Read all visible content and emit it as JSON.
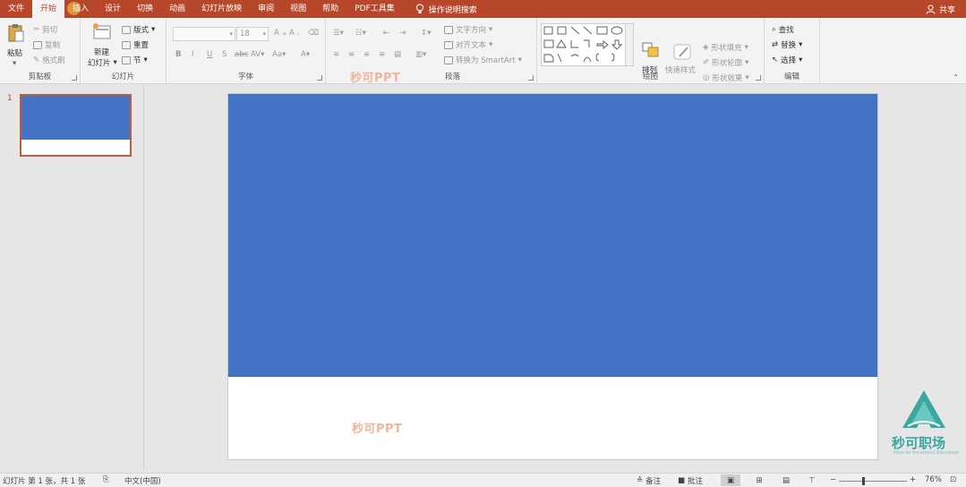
{
  "tabs": [
    "文件",
    "开始",
    "插入",
    "设计",
    "切换",
    "动画",
    "幻灯片放映",
    "审阅",
    "视图",
    "帮助",
    "PDF工具集"
  ],
  "active_tab": "开始",
  "tell_me": "操作说明搜索",
  "share": "共享",
  "clipboard": {
    "paste": "粘贴",
    "cut": "剪切",
    "copy": "复制",
    "format_painter": "格式刷",
    "label": "剪贴板"
  },
  "slides_group": {
    "new_slide_1": "新建",
    "new_slide_2": "幻灯片",
    "layout": "版式",
    "reset": "重置",
    "section": "节",
    "label": "幻灯片"
  },
  "font_group": {
    "font_size": "18",
    "label": "字体"
  },
  "paragraph_group": {
    "text_direction": "文字方向",
    "align_text": "对齐文本",
    "smartart": "转换为 SmartArt",
    "label": "段落"
  },
  "drawing_group": {
    "arrange": "排列",
    "quick_styles": "快速样式",
    "shape_fill": "形状填充",
    "shape_outline": "形状轮廓",
    "shape_effects": "形状效果",
    "label": "绘图"
  },
  "editing_group": {
    "find": "查找",
    "replace": "替换",
    "select": "选择",
    "label": "编辑"
  },
  "watermark": "秒可PPT",
  "thumbnail": {
    "number": "1"
  },
  "logo": {
    "name": "秒可职场",
    "sub": "Miao ke Vocational Education"
  },
  "status": {
    "slide_info": "幻灯片 第 1 张，共 1 张",
    "language": "中文(中国)",
    "notes": "备注",
    "comments": "批注",
    "zoom": "76%"
  },
  "colors": {
    "accent": "#b7472a",
    "slide_blue": "#4472c4",
    "logo_teal": "#3aa8a0"
  }
}
